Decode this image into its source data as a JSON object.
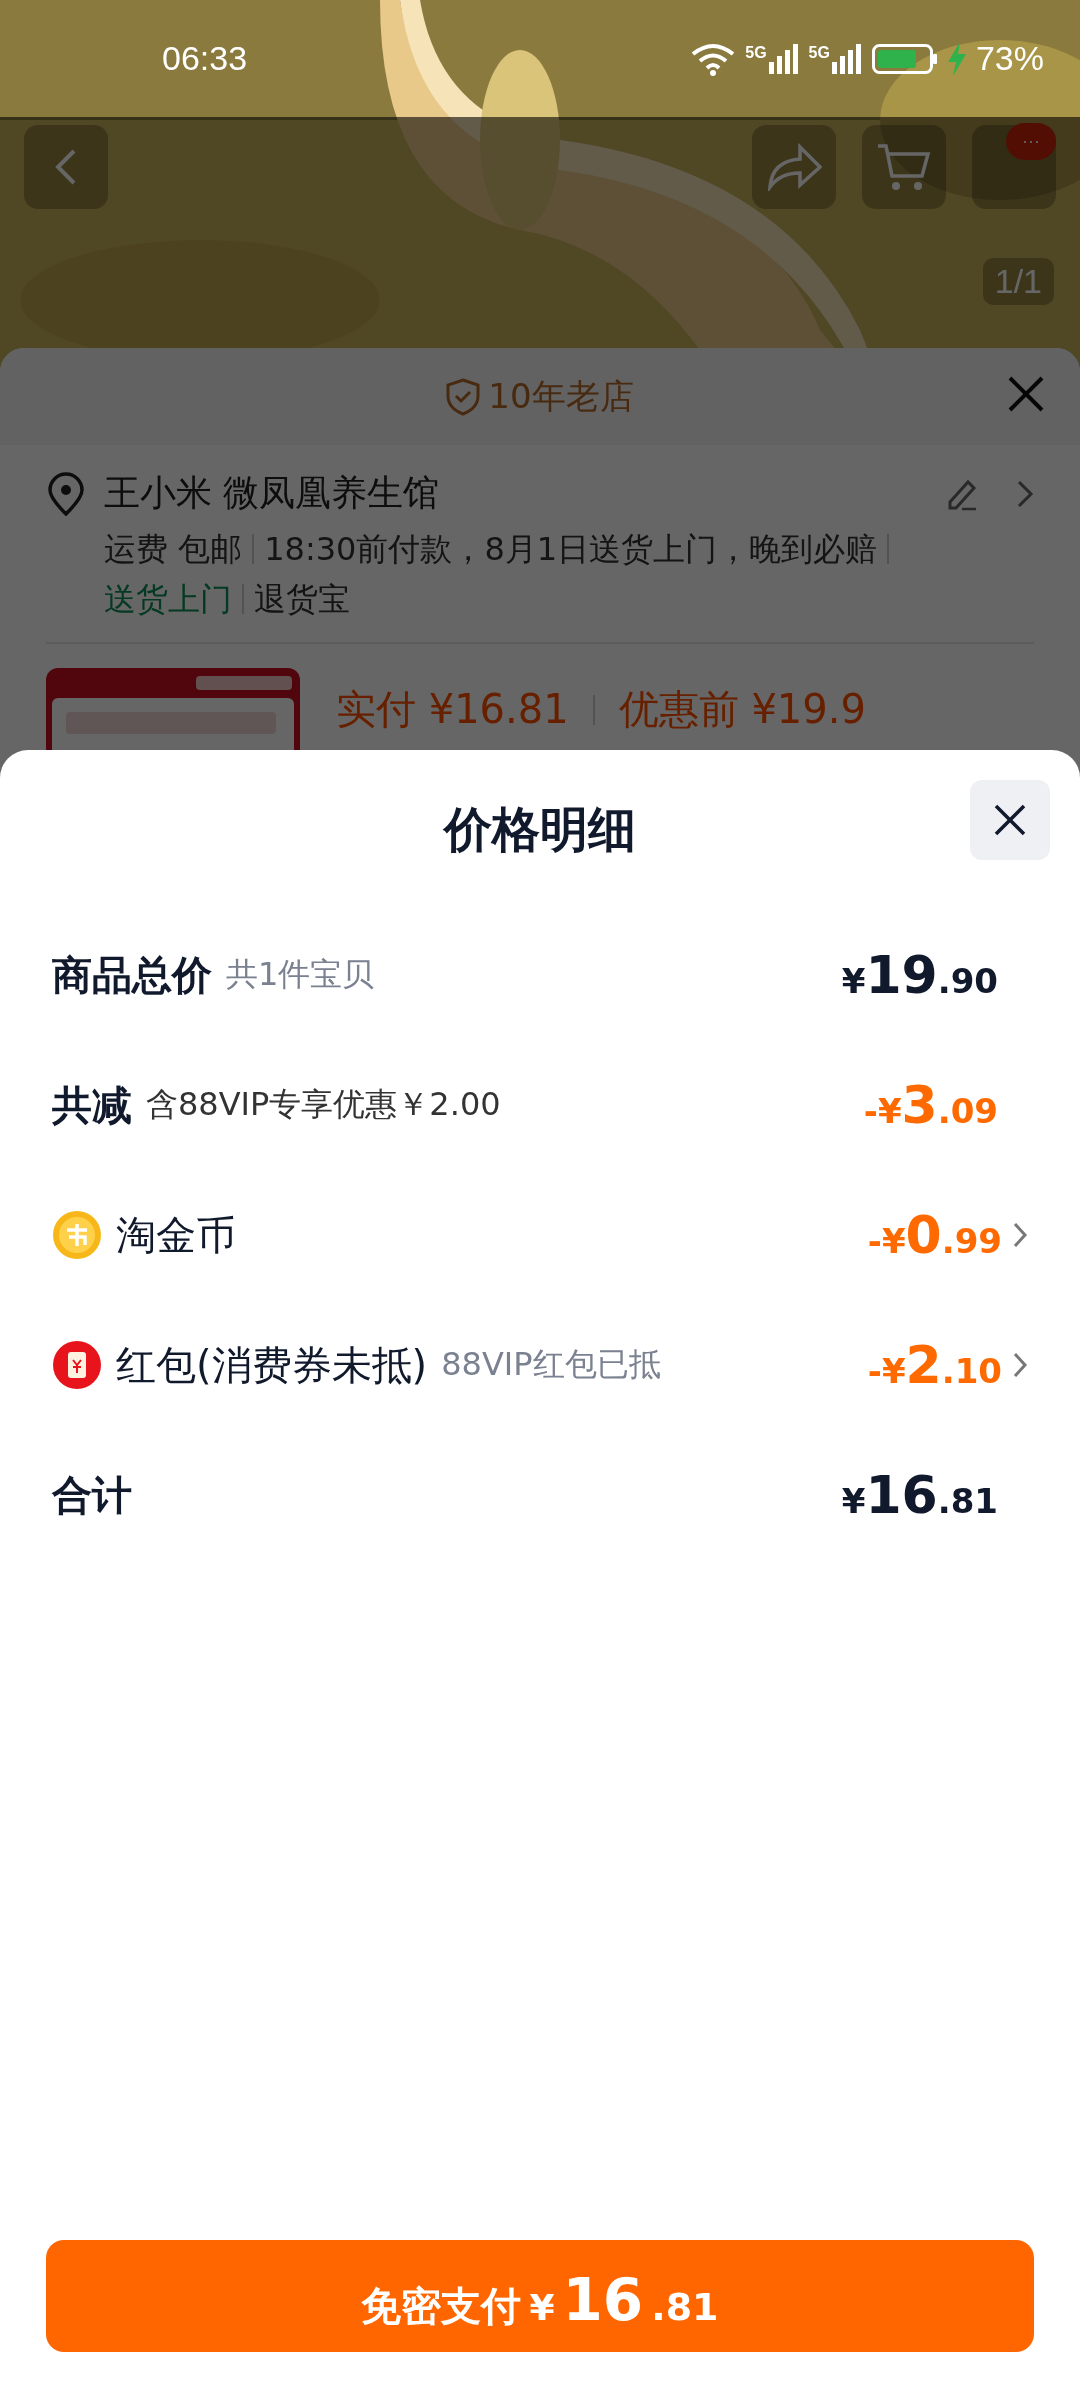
{
  "status_bar": {
    "time": "06:33",
    "network_labels": [
      "5G",
      "5G"
    ],
    "battery_text": "73%"
  },
  "product_page": {
    "image_counter": "1/1",
    "more_badge": "···",
    "shop_badge": "10年老店",
    "address": {
      "name": "王小米 微凤凰养生馆",
      "details": [
        "运费 包邮",
        "18:30前付款，8月1日送货上门，晚到必赔"
      ],
      "tags": [
        {
          "text": "送货上门",
          "highlight": true
        },
        {
          "text": "退货宝",
          "highlight": false
        }
      ]
    },
    "price_line": {
      "paid": "实付 ¥16.81",
      "before": "优惠前 ¥19.9"
    }
  },
  "price_sheet": {
    "title": "价格明细",
    "rows": [
      {
        "label": "商品总价",
        "note": "共1件宝贝",
        "amount": "¥19.90",
        "highlight": false,
        "kind": "heading"
      },
      {
        "label": "共减",
        "note": "含88VIP专享优惠￥2.00",
        "amount": "-¥3.09",
        "highlight": true,
        "kind": "heading"
      },
      {
        "label": "淘金币",
        "amount": "-¥0.99",
        "highlight": true,
        "kind": "coin"
      },
      {
        "label": "红包(消费券未抵)",
        "note": "88VIP红包已抵",
        "amount": "-¥2.10",
        "highlight": true,
        "kind": "envelope"
      },
      {
        "label": "合计",
        "amount": "¥16.81",
        "highlight": false,
        "kind": "total"
      }
    ]
  },
  "pay_button": {
    "label": "免密支付",
    "amount": "¥16.81"
  }
}
